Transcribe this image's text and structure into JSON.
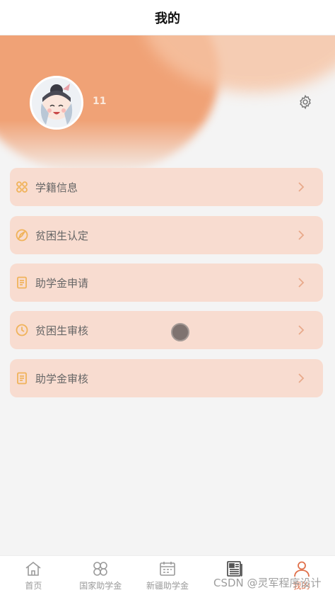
{
  "header": {
    "title": "我的"
  },
  "profile": {
    "username": "11"
  },
  "menu": {
    "items": [
      {
        "label": "学籍信息",
        "icon": "grid-icon"
      },
      {
        "label": "贫困生认定",
        "icon": "edit-circle-icon"
      },
      {
        "label": "助学金申请",
        "icon": "document-icon"
      },
      {
        "label": "贫困生审核",
        "icon": "clock-icon"
      },
      {
        "label": "助学金审核",
        "icon": "document-icon"
      }
    ]
  },
  "tabbar": {
    "tabs": [
      {
        "label": "首页",
        "icon": "home-icon"
      },
      {
        "label": "国家助学金",
        "icon": "clover-icon"
      },
      {
        "label": "新疆助学金",
        "icon": "calendar-icon"
      },
      {
        "label": "",
        "icon": "newspaper-icon"
      },
      {
        "label": "我的",
        "icon": "user-icon"
      }
    ],
    "active_index": 4
  },
  "watermark": "CSDN @灵军程序设计",
  "colors": {
    "accent": "#e0714b",
    "hero": "#f0a276",
    "menu_bg": "#f8dcd0",
    "icon": "#f0b35b"
  }
}
